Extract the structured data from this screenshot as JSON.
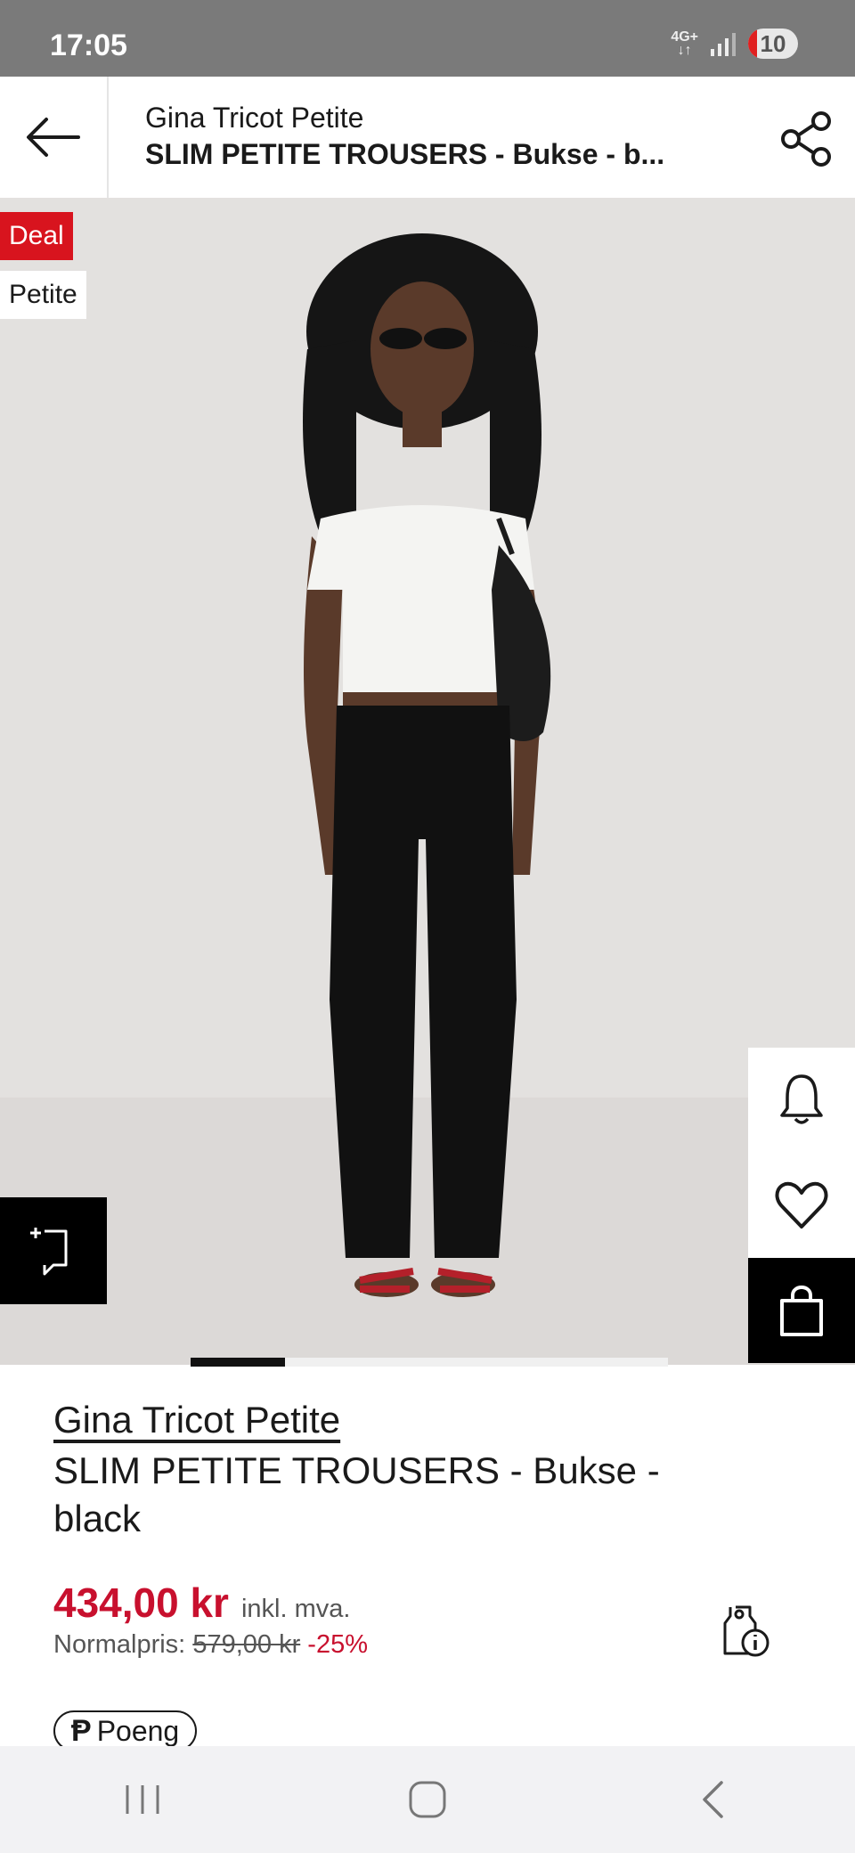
{
  "status_bar": {
    "time": "17:05",
    "network": "4G+",
    "battery": "10"
  },
  "header": {
    "brand": "Gina Tricot Petite",
    "title": "SLIM PETITE TROUSERS - Bukse - b..."
  },
  "badges": {
    "deal": "Deal",
    "petite": "Petite"
  },
  "product": {
    "brand": "Gina Tricot Petite",
    "title_line1": "SLIM PETITE TROUSERS - Bukse -",
    "title_line2": "black",
    "price": "434,00 kr",
    "vat": "inkl. mva.",
    "normal_label": "Normalpris:",
    "normal_price": "579,00 kr",
    "discount": "-25%",
    "points_label": "Poeng"
  },
  "icons": {
    "back": "back-arrow-icon",
    "share": "share-icon",
    "notify": "bell-icon",
    "wishlist": "heart-icon",
    "bag": "shopping-bag-icon",
    "compare": "compare-icon",
    "price_info": "price-tag-info-icon"
  },
  "colors": {
    "accent_red": "#c8102e",
    "deal_red": "#d8141e",
    "black": "#000000"
  },
  "carousel": {
    "active_index": 0,
    "count": 5
  }
}
